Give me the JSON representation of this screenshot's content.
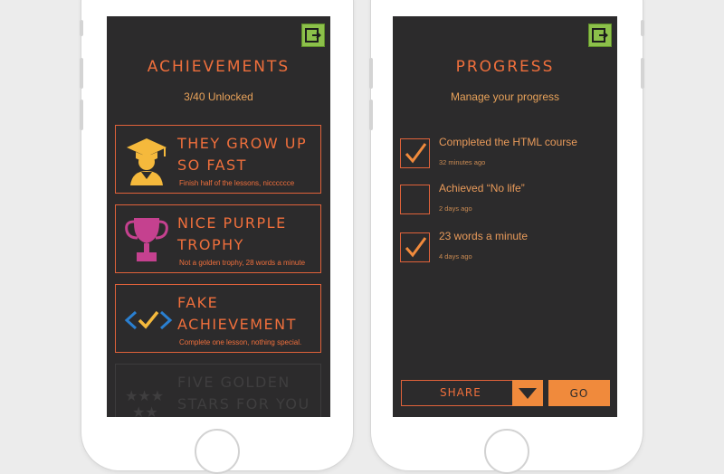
{
  "achievements_screen": {
    "title": "ACHIEVEMENTS",
    "unlocked_count": "3/40 Unlocked",
    "cards": [
      {
        "title": "They grow up so fast",
        "desc": "Finish half of the lessons, nicccccce",
        "icon": "graduate-icon"
      },
      {
        "title": "Nice purple trophy",
        "desc": "Not a golden trophy, 28 words a minute",
        "icon": "trophy-icon"
      },
      {
        "title": "Fake achievement",
        "desc": "Complete one lesson, nothing special.",
        "icon": "code-check-icon"
      },
      {
        "title": "Five golden stars for you",
        "desc": "",
        "icon": "stars-icon",
        "locked": true
      }
    ]
  },
  "progress_screen": {
    "title": "PROGRESS",
    "subtitle": "Manage your progress",
    "items": [
      {
        "label": "Completed the HTML course",
        "time": "32 minutes ago",
        "checked": true
      },
      {
        "label": "Achieved  “No life”",
        "time": "2 days ago",
        "checked": false
      },
      {
        "label": "23 words a minute",
        "time": "4 days ago",
        "checked": true
      }
    ],
    "share_label": "SHARE",
    "go_label": "GO"
  },
  "colors": {
    "screen_bg": "#2c2b2c",
    "accent_orange": "#ef6f3c",
    "button_orange": "#f08a3c",
    "exit_green": "#8cc04a",
    "trophy_purple": "#c5418f",
    "graduate_yellow": "#f5b93c",
    "code_blue": "#2a7fd0"
  }
}
